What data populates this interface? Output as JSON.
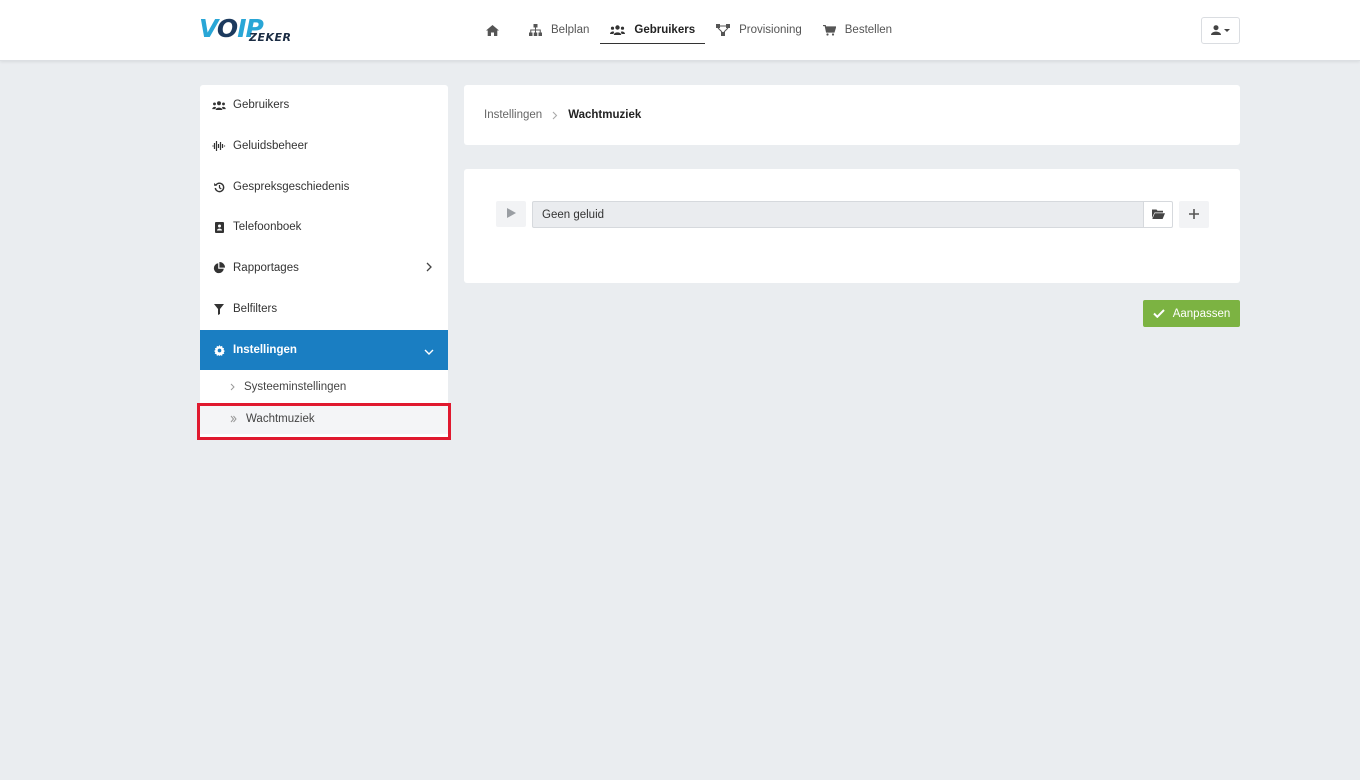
{
  "header": {
    "logo_text_main": "VOIP",
    "logo_text_sub": "ZEKER",
    "nav": [
      {
        "label": "",
        "icon": "home-icon"
      },
      {
        "label": "Belplan",
        "icon": "sitemap-icon"
      },
      {
        "label": "Gebruikers",
        "icon": "users-icon",
        "active": true
      },
      {
        "label": "Provisioning",
        "icon": "network-icon"
      },
      {
        "label": "Bestellen",
        "icon": "cart-icon"
      }
    ],
    "user_menu_icon": "user-icon"
  },
  "sidebar": {
    "items": [
      {
        "label": "Gebruikers",
        "icon": "users-icon"
      },
      {
        "label": "Geluidsbeheer",
        "icon": "waveform-icon"
      },
      {
        "label": "Gespreksgeschiedenis",
        "icon": "history-icon"
      },
      {
        "label": "Telefoonboek",
        "icon": "address-book-icon"
      },
      {
        "label": "Rapportages",
        "icon": "pie-chart-icon"
      },
      {
        "label": "Belfilters",
        "icon": "filter-icon"
      },
      {
        "label": "Instellingen",
        "icon": "gear-icon"
      }
    ],
    "subitems": [
      {
        "label": "Systeeminstellingen"
      },
      {
        "label": "Wachtmuziek"
      }
    ]
  },
  "breadcrumb": {
    "parent": "Instellingen",
    "current": "Wachtmuziek"
  },
  "music": {
    "selected_sound": "Geen geluid"
  },
  "actions": {
    "save_label": "Aanpassen"
  },
  "colors": {
    "accent_blue": "#1a7ec2",
    "success_green": "#7cb342",
    "highlight_red": "#e0192f",
    "background": "#eaedf0"
  }
}
